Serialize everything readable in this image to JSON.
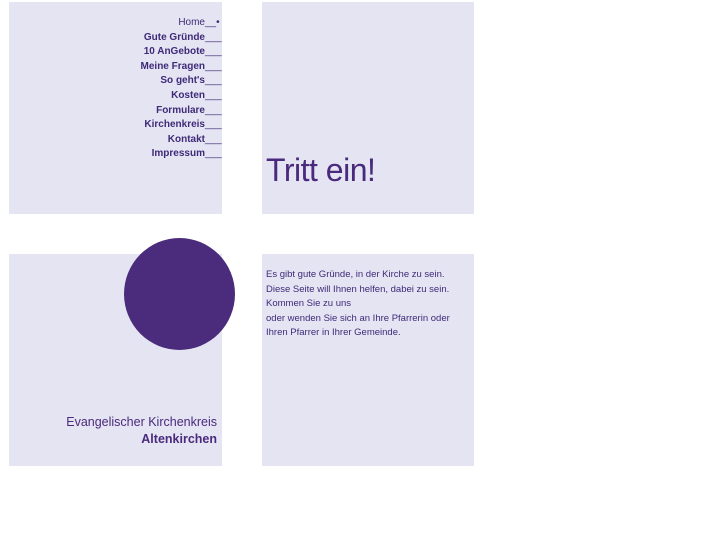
{
  "nav": {
    "items": [
      {
        "label": "Home",
        "marker": "__•"
      },
      {
        "label": "Gute Gründe",
        "marker": "___"
      },
      {
        "label": "10 AnGebote",
        "marker": "___"
      },
      {
        "label": "Meine Fragen",
        "marker": "___"
      },
      {
        "label": "So geht's",
        "marker": "___"
      },
      {
        "label": "Kosten",
        "marker": "___"
      },
      {
        "label": "Formulare",
        "marker": "___"
      },
      {
        "label": "Kirchenkreis",
        "marker": "___"
      },
      {
        "label": "Kontakt",
        "marker": "___"
      },
      {
        "label": "Impressum",
        "marker": "___"
      }
    ]
  },
  "hero": {
    "title": "Tritt ein!"
  },
  "brand": {
    "line1": "Evangelischer Kirchenkreis",
    "line2": "Altenkirchen"
  },
  "intro": {
    "lines": [
      "Es gibt gute Gründe, in der Kirche zu sein.",
      "Diese Seite will Ihnen helfen, dabei zu sein.",
      "Kommen Sie zu uns",
      "oder wenden Sie sich an Ihre Pfarrerin oder",
      "Ihren Pfarrer in Ihrer Gemeinde."
    ]
  },
  "colors": {
    "panel": "#e4e4f2",
    "accent": "#4b2b7b",
    "text": "#3f2a78"
  }
}
